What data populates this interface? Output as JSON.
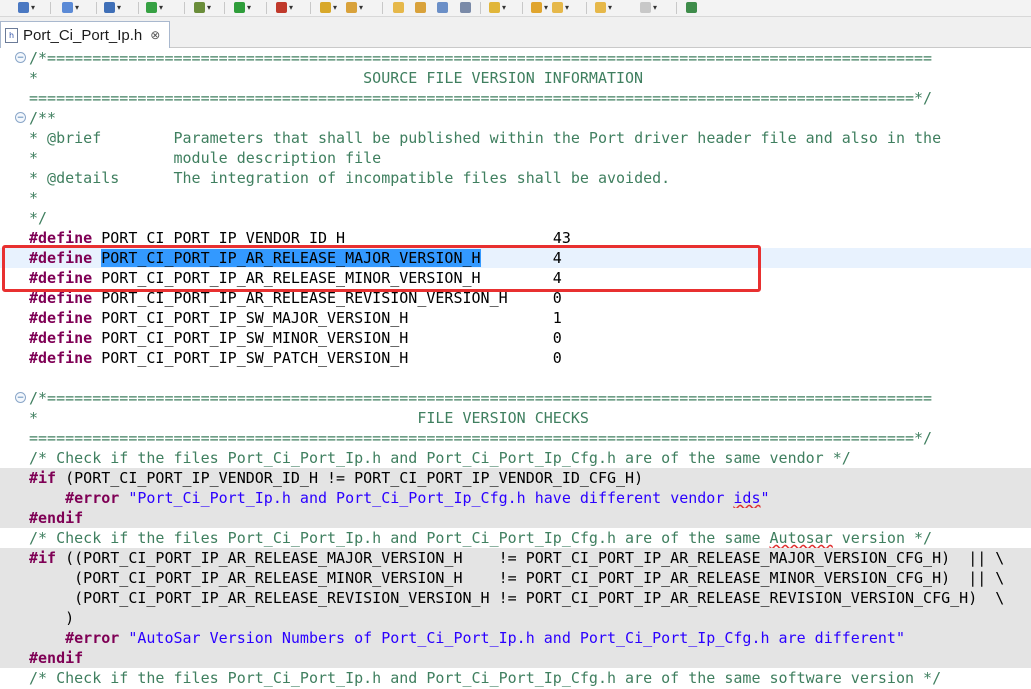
{
  "toolbar": {
    "icons": [
      {
        "name": "project-icon",
        "color": "#4a78c2"
      },
      {
        "name": "new-type-icon",
        "color": "#5b8ad6"
      },
      {
        "name": "new-class-icon",
        "color": "#3f6fb7"
      },
      {
        "name": "refresh-icon",
        "color": "#36a143"
      },
      {
        "name": "debug-icon",
        "color": "#6a8d3a"
      },
      {
        "name": "run-icon",
        "color": "#2e9d3a"
      },
      {
        "name": "external-tools-icon",
        "color": "#c0392b"
      },
      {
        "name": "open-folder-icon",
        "color": "#d8a82a"
      },
      {
        "name": "pen-icon",
        "color": "#d9a23b"
      },
      {
        "name": "highlight-icon",
        "color": "#e6b84a"
      },
      {
        "name": "toggle-mark-icon",
        "color": "#d9a23b"
      },
      {
        "name": "block-select-icon",
        "color": "#6b8fc7"
      },
      {
        "name": "pilcrow-icon",
        "color": "#7a8aa8"
      },
      {
        "name": "annotation-icon",
        "color": "#e1b63a"
      },
      {
        "name": "up-arrow-icon",
        "color": "#e0a52e"
      },
      {
        "name": "back-icon",
        "color": "#e6b84a"
      },
      {
        "name": "back-history-icon",
        "color": "#e6b84a"
      },
      {
        "name": "forward-icon",
        "color": "#c8c8c8"
      },
      {
        "name": "new-window-icon",
        "color": "#3e8c4a"
      }
    ]
  },
  "tab": {
    "title": "Port_Ci_Port_Ip.h",
    "close": "⊗"
  },
  "code": {
    "l1": "/*==================================================================================================",
    "l2": "*                                    SOURCE FILE VERSION INFORMATION",
    "l3": "==================================================================================================*/",
    "l4": "/**",
    "l5a": "* @brief        ",
    "l5b": "Parameters that shall be published within the Port driver header file and also in the",
    "l6": "*               module description file",
    "l7a": "* @details      ",
    "l7b": "The integration of incompatible files shall be avoided.",
    "l8": "*",
    "l9": "*/",
    "kw_define": "#define",
    "d1_name": "PORT_CI_PORT_IP_VENDOR_ID_H",
    "d1_pad": "                       ",
    "d1_val": "43",
    "d2_name": "PORT_CI_PORT_IP_AR_RELEASE_MAJOR_VERSION_H",
    "d2_pad": "        ",
    "d2_val": "4",
    "d3_name": "PORT_CI_PORT_IP_AR_RELEASE_MINOR_VERSION_H",
    "d3_pad": "        ",
    "d3_val": "4",
    "d4_name": "PORT_CI_PORT_IP_AR_RELEASE_REVISION_VERSION_H",
    "d4_pad": "     ",
    "d4_val": "0",
    "d5_name": "PORT_CI_PORT_IP_SW_MAJOR_VERSION_H",
    "d5_pad": "                ",
    "d5_val": "1",
    "d6_name": "PORT_CI_PORT_IP_SW_MINOR_VERSION_H",
    "d6_pad": "                ",
    "d6_val": "0",
    "d7_name": "PORT_CI_PORT_IP_SW_PATCH_VERSION_H",
    "d7_pad": "                ",
    "d7_val": "0",
    "l18": "/*==================================================================================================",
    "l19": "*                                          FILE VERSION CHECKS",
    "l20": "==================================================================================================*/",
    "l21": "/* Check if the files Port_Ci_Port_Ip.h and Port_Ci_Port_Ip_Cfg.h are of the same vendor */",
    "kw_if": "#if",
    "l22": " (PORT_CI_PORT_IP_VENDOR_ID_H != PORT_CI_PORT_IP_VENDOR_ID_CFG_H)",
    "l23_ind": "    ",
    "kw_error": "#error",
    "l23_str": " \"Port_Ci_Port_Ip.h and Port_Ci_Port_Ip_Cfg.h have different vendor ",
    "l23_sq": "ids",
    "l23_end": "\"",
    "kw_endif": "#endif",
    "l25a": "/* Check if the files Port_Ci_Port_Ip.h and Port_Ci_Port_Ip_Cfg.h are of the same ",
    "l25sq": "Autosar",
    "l25b": " version */",
    "l26": " ((PORT_CI_PORT_IP_AR_RELEASE_MAJOR_VERSION_H    != PORT_CI_PORT_IP_AR_RELEASE_MAJOR_VERSION_CFG_H)  || \\",
    "l27": "     (PORT_CI_PORT_IP_AR_RELEASE_MINOR_VERSION_H    != PORT_CI_PORT_IP_AR_RELEASE_MINOR_VERSION_CFG_H)  || \\",
    "l28": "     (PORT_CI_PORT_IP_AR_RELEASE_REVISION_VERSION_H != PORT_CI_PORT_IP_AR_RELEASE_REVISION_VERSION_CFG_H)  \\",
    "l29": "    )",
    "l30_str": " \"AutoSar Version Numbers of Port_Ci_Port_Ip.h and Port_Ci_Port_Ip_Cfg.h are different\"",
    "l32": "/* Check if the files Port_Ci_Port_Ip.h and Port_Ci_Port_Ip_Cfg.h are of the same software version */"
  }
}
